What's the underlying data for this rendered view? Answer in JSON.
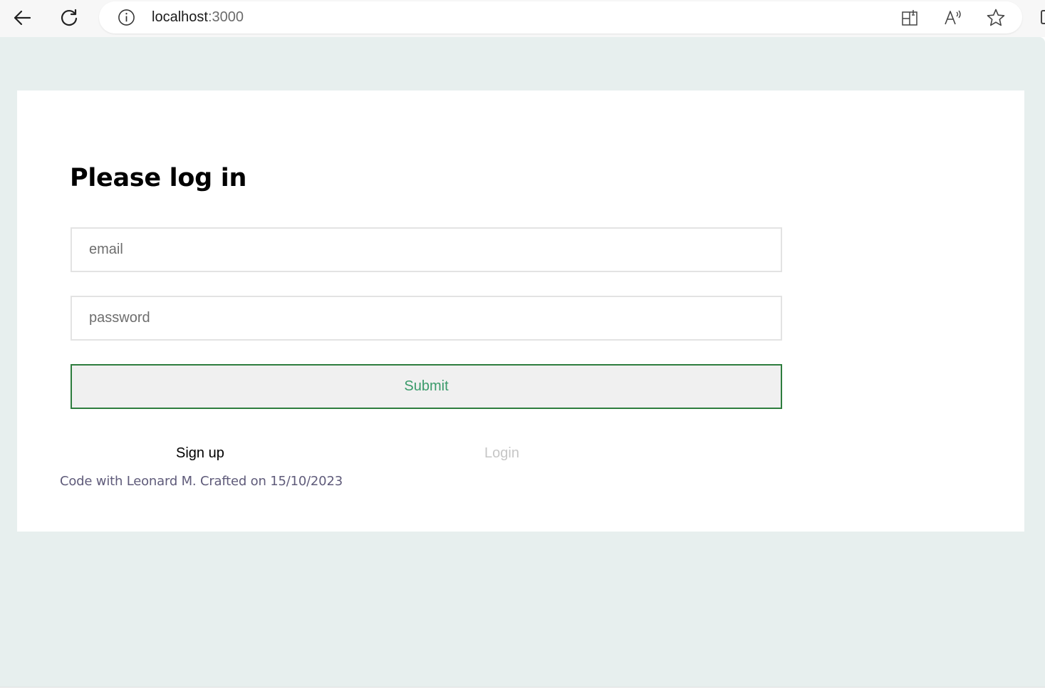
{
  "browser": {
    "url_host": "localhost",
    "url_port": ":3000",
    "icons": {
      "back": "back-arrow-icon",
      "reload": "reload-icon",
      "info": "info-icon",
      "split_screen": "split-screen-icon",
      "read_aloud": "read-aloud-icon",
      "favorite": "star-icon"
    }
  },
  "page": {
    "title": "Please log in",
    "email_placeholder": "email",
    "password_placeholder": "password",
    "submit_label": "Submit",
    "signup_label": "Sign up",
    "login_label": "Login",
    "footer": "Code with Leonard M. Crafted on 15/10/2023"
  },
  "colors": {
    "page_background": "#e7efee",
    "card_background": "#ffffff",
    "submit_border": "#2e7d3e",
    "submit_text": "#3a9a6a",
    "login_disabled_text": "#c6c6c6",
    "footer_text": "#5f5b7a"
  }
}
